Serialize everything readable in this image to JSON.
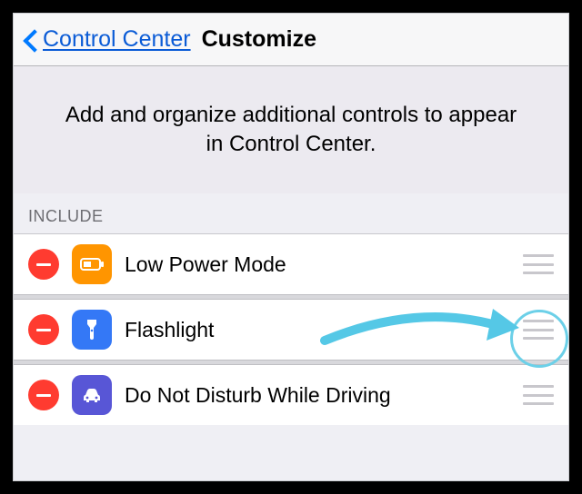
{
  "nav": {
    "back_label": "Control Center",
    "title": "Customize"
  },
  "description": "Add and organize additional controls to appear in Control Center.",
  "section_header": "INCLUDE",
  "rows": [
    {
      "label": "Low Power Mode",
      "icon": "battery",
      "bg": "#ff9500"
    },
    {
      "label": "Flashlight",
      "icon": "flashlight",
      "bg": "#3478f6"
    },
    {
      "label": "Do Not Disturb While Driving",
      "icon": "car",
      "bg": "#5856d6"
    }
  ]
}
